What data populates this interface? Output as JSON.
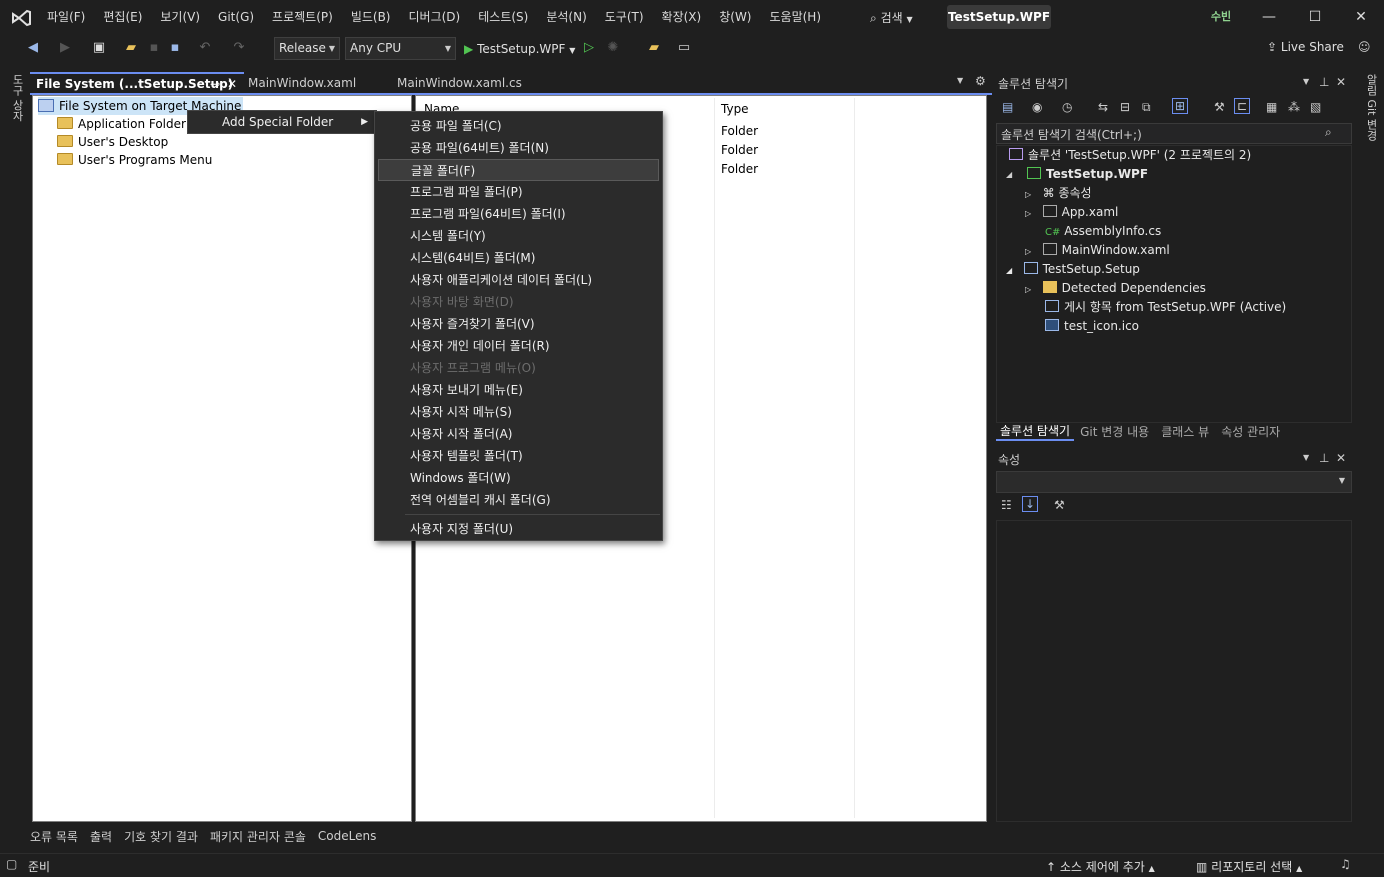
{
  "titlebar": {
    "menu": [
      "파일(F)",
      "편집(E)",
      "보기(V)",
      "Git(G)",
      "프로젝트(P)",
      "빌드(B)",
      "디버그(D)",
      "테스트(S)",
      "분석(N)",
      "도구(T)",
      "확장(X)",
      "창(W)",
      "도움말(H)"
    ],
    "search": "검색",
    "solution_title": "TestSetup.WPF",
    "user": "수빈"
  },
  "toolbar": {
    "configuration": "Release",
    "platform": "Any CPU",
    "startup_project": "TestSetup.WPF",
    "live_share": "Live Share"
  },
  "side_strips": {
    "left": "도구 상자",
    "right": "알림 Git 변경"
  },
  "doc_tabs": [
    {
      "label": "File System (...tSetup.Setup)",
      "active": true
    },
    {
      "label": "MainWindow.xaml",
      "active": false
    },
    {
      "label": "MainWindow.xaml.cs",
      "active": false
    }
  ],
  "fs_tree": {
    "root": "File System on Target Machine",
    "items": [
      "Application Folder",
      "User's Desktop",
      "User's Programs Menu"
    ]
  },
  "fs_list": {
    "columns": [
      "Name",
      "Type"
    ],
    "types": [
      "Folder",
      "Folder",
      "Folder"
    ]
  },
  "context_menu": {
    "parent": "Add Special Folder",
    "items": [
      {
        "label": "공용 파일 폴더(C)",
        "disabled": false
      },
      {
        "label": "공용 파일(64비트) 폴더(N)",
        "disabled": false
      },
      {
        "label": "글꼴 폴더(F)",
        "disabled": false,
        "highlighted": true
      },
      {
        "label": "프로그램 파일 폴더(P)",
        "disabled": false
      },
      {
        "label": "프로그램 파일(64비트) 폴더(I)",
        "disabled": false
      },
      {
        "label": "시스템 폴더(Y)",
        "disabled": false
      },
      {
        "label": "시스템(64비트) 폴더(M)",
        "disabled": false
      },
      {
        "label": "사용자 애플리케이션 데이터 폴더(L)",
        "disabled": false
      },
      {
        "label": "사용자 바탕 화면(D)",
        "disabled": true
      },
      {
        "label": "사용자 즐겨찾기 폴더(V)",
        "disabled": false
      },
      {
        "label": "사용자 개인 데이터 폴더(R)",
        "disabled": false
      },
      {
        "label": "사용자 프로그램 메뉴(O)",
        "disabled": true
      },
      {
        "label": "사용자 보내기 메뉴(E)",
        "disabled": false
      },
      {
        "label": "사용자 시작 메뉴(S)",
        "disabled": false
      },
      {
        "label": "사용자 시작 폴더(A)",
        "disabled": false
      },
      {
        "label": "사용자 템플릿 폴더(T)",
        "disabled": false
      },
      {
        "label": "Windows 폴더(W)",
        "disabled": false
      },
      {
        "label": "전역 어셈블리 캐시 폴더(G)",
        "disabled": false
      }
    ],
    "last": "사용자 지정 폴더(U)"
  },
  "solution_explorer": {
    "title": "솔루션 탐색기",
    "search_placeholder": "솔루션 탐색기 검색(Ctrl+;)",
    "solution": "솔루션 'TestSetup.WPF'  (2 프로젝트의 2)",
    "items": {
      "proj1": "TestSetup.WPF",
      "deps": "종속성",
      "app": "App.xaml",
      "asm": "AssemblyInfo.cs",
      "main": "MainWindow.xaml",
      "proj2": "TestSetup.Setup",
      "detected": "Detected Dependencies",
      "output": "게시 항목 from TestSetup.WPF (Active)",
      "icon": "test_icon.ico"
    },
    "tabs": [
      "솔루션 탐색기",
      "Git 변경 내용",
      "클래스 뷰",
      "속성 관리자"
    ]
  },
  "properties": {
    "title": "속성"
  },
  "bottom_tabs": [
    "오류 목록",
    "출력",
    "기호 찾기 결과",
    "패키지 관리자 콘솔",
    "CodeLens"
  ],
  "status": {
    "ready": "준비",
    "source_control": "소스 제어에 추가",
    "repo": "리포지토리 선택"
  }
}
